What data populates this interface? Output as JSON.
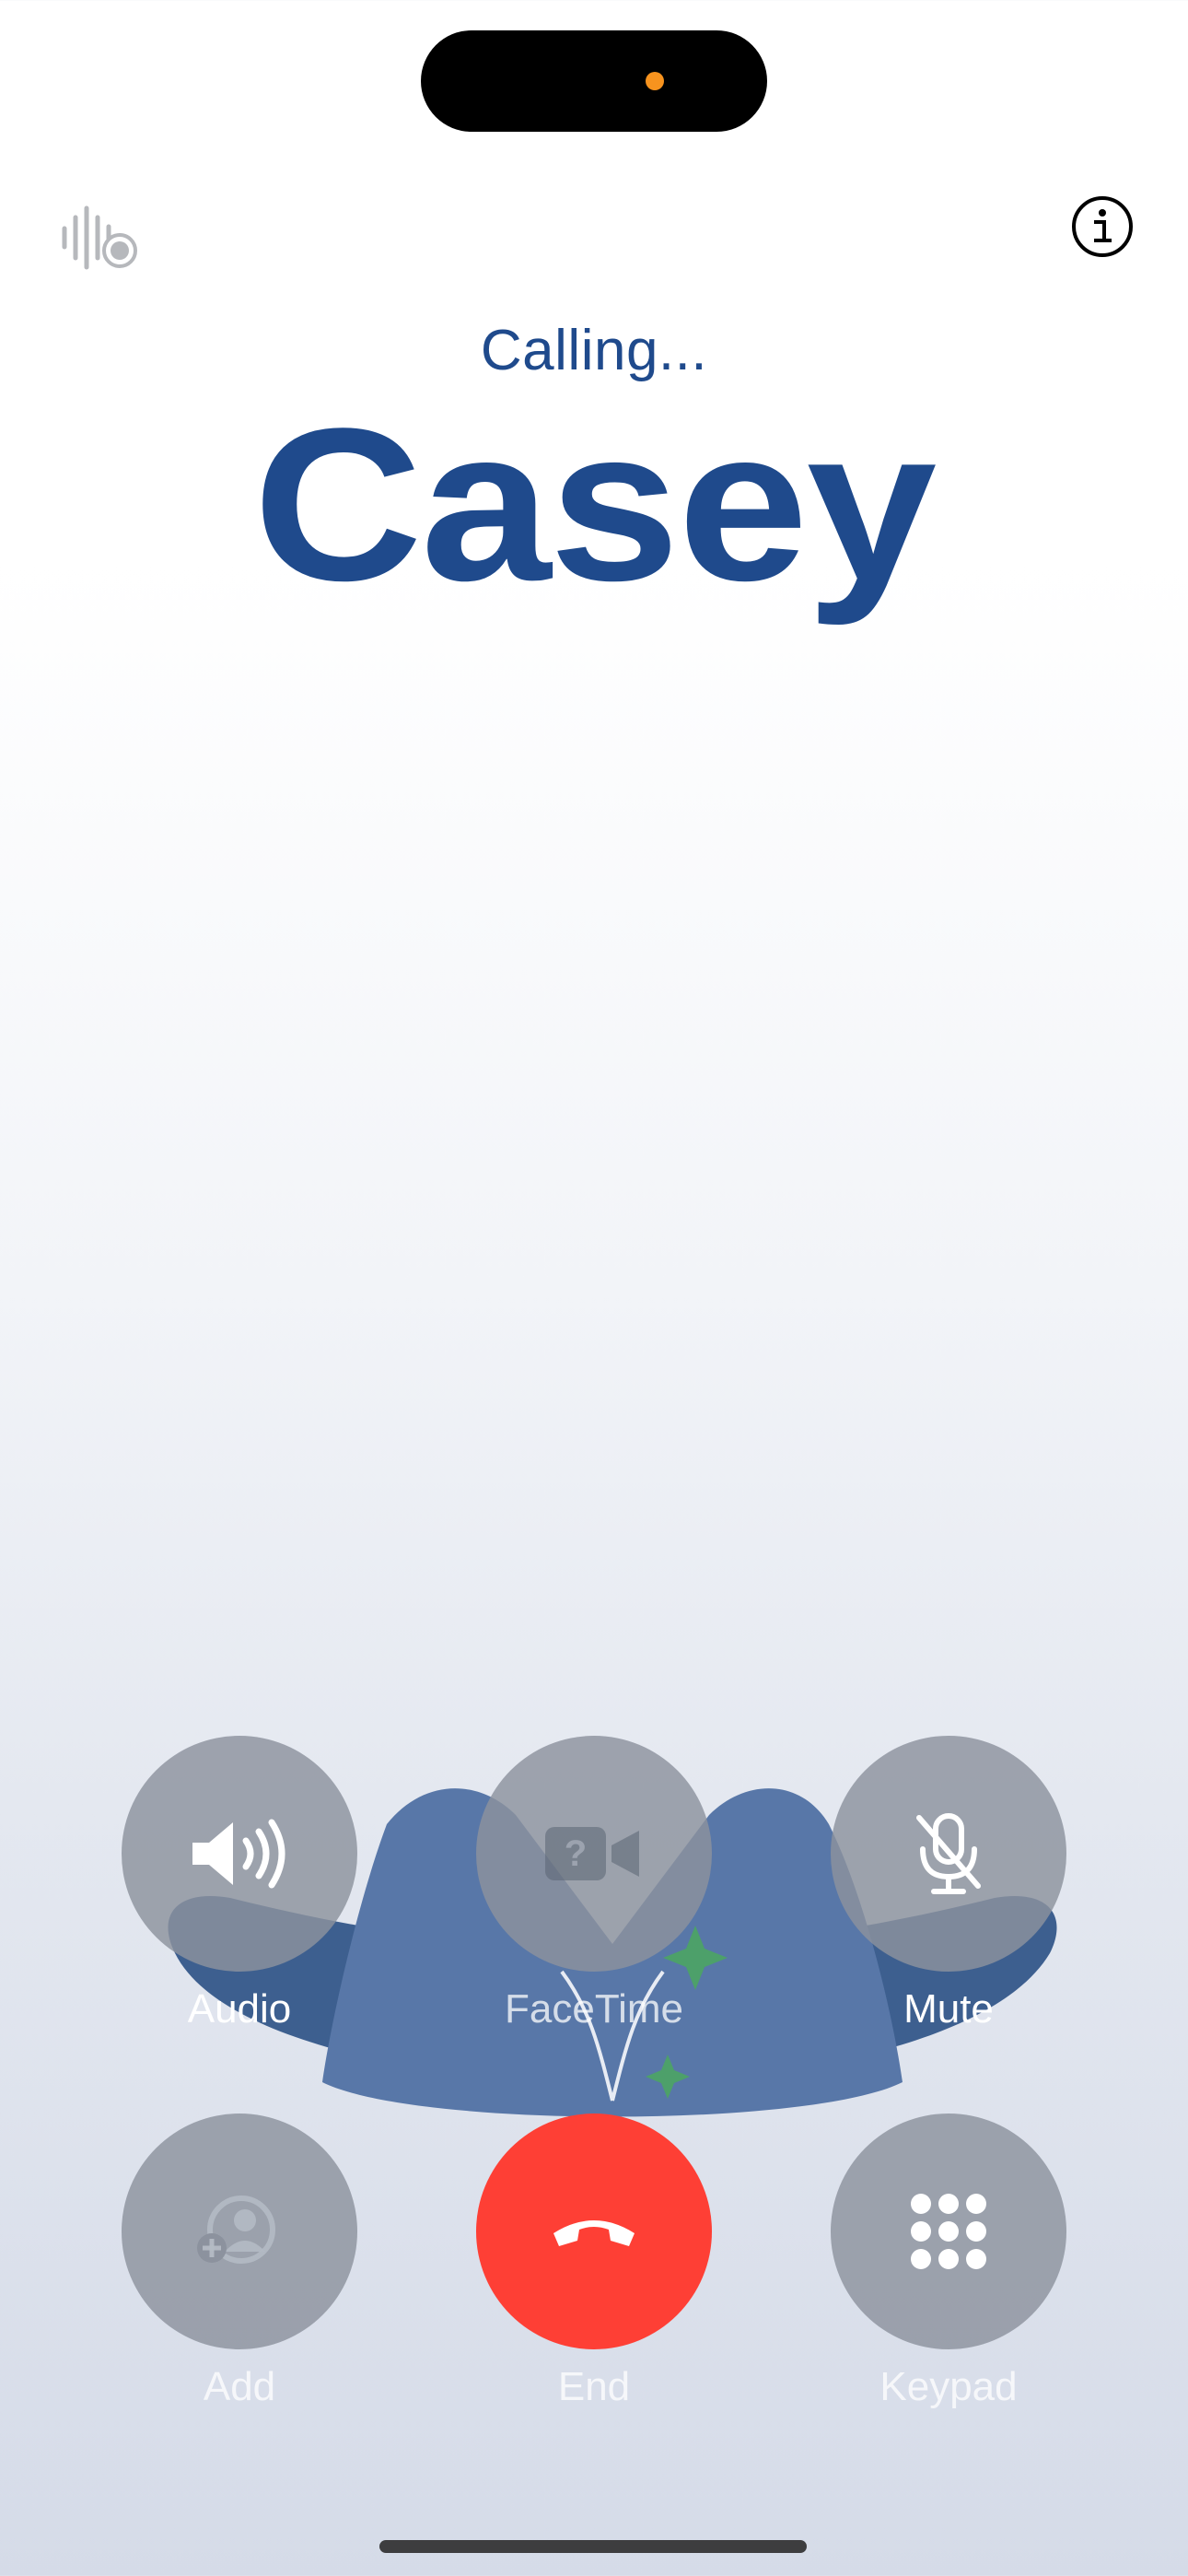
{
  "status": {
    "text": "Calling..."
  },
  "caller": {
    "name": "Casey"
  },
  "icons": {
    "top_left": "audio-waveform-icon",
    "top_right": "info-icon"
  },
  "controls": [
    {
      "id": "audio",
      "label": "Audio",
      "icon": "speaker-icon",
      "enabled": true
    },
    {
      "id": "facetime",
      "label": "FaceTime",
      "icon": "video-camera-icon",
      "enabled": false
    },
    {
      "id": "mute",
      "label": "Mute",
      "icon": "microphone-slash-icon",
      "enabled": true
    },
    {
      "id": "add",
      "label": "Add",
      "icon": "add-person-icon",
      "enabled": false
    },
    {
      "id": "end",
      "label": "End",
      "icon": "phone-hangup-icon",
      "enabled": true
    },
    {
      "id": "keypad",
      "label": "Keypad",
      "icon": "keypad-icon",
      "enabled": true
    }
  ],
  "colors": {
    "name_blue": "#1f4a8c",
    "end_red": "#fe3f35",
    "island_dot": "#f7931e"
  }
}
